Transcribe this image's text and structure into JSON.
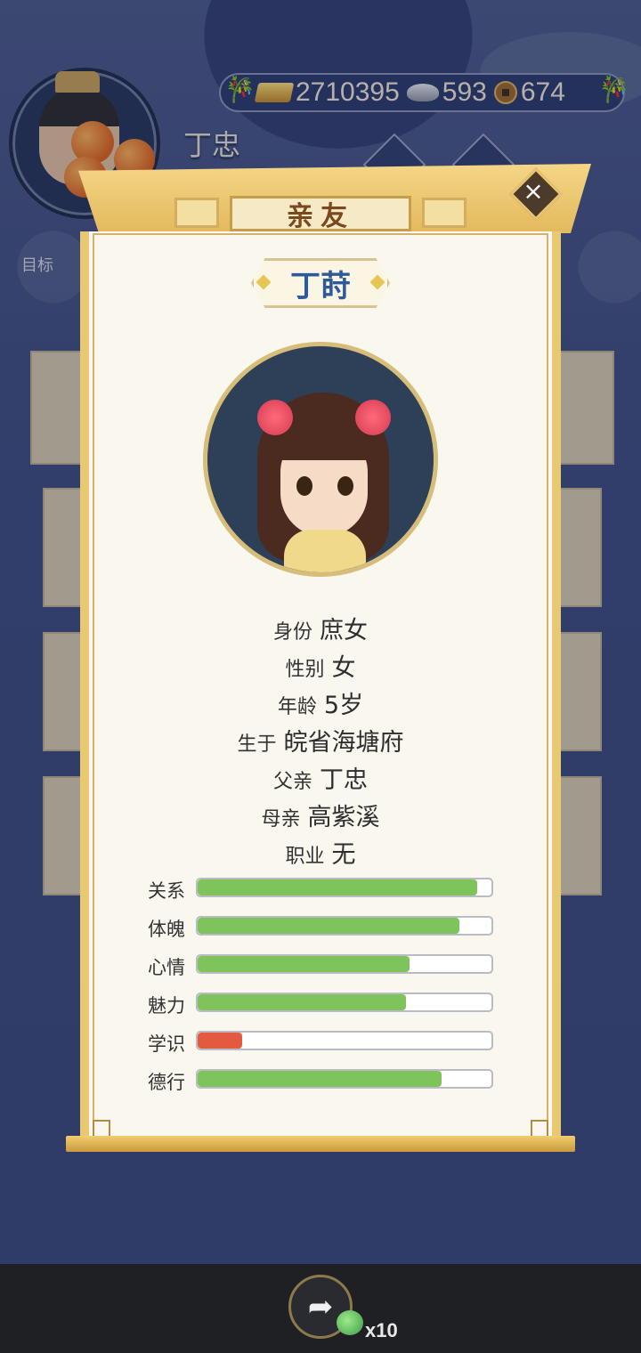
{
  "hud": {
    "player_name": "丁忠",
    "currency": {
      "gold": "2710395",
      "silver": "593",
      "copper": "674"
    },
    "goal_label": "目标"
  },
  "dialog": {
    "title": "亲友",
    "close_label": "×",
    "person_name": "丁莳",
    "info": [
      {
        "key": "身份",
        "value": "庶女"
      },
      {
        "key": "性别",
        "value": "女"
      },
      {
        "key": "年龄",
        "value": "5岁"
      },
      {
        "key": "生于",
        "value": "皖省海塘府"
      },
      {
        "key": "父亲",
        "value": "丁忠"
      },
      {
        "key": "母亲",
        "value": "高紫溪"
      },
      {
        "key": "职业",
        "value": "无"
      }
    ],
    "stats": [
      {
        "label": "关系",
        "fraction": 0.95,
        "color": "#7ec45a"
      },
      {
        "label": "体魄",
        "fraction": 0.89,
        "color": "#7ec45a"
      },
      {
        "label": "心情",
        "fraction": 0.72,
        "color": "#7ec45a"
      },
      {
        "label": "魅力",
        "fraction": 0.71,
        "color": "#7ec45a"
      },
      {
        "label": "学识",
        "fraction": 0.15,
        "color": "#e35a40"
      },
      {
        "label": "德行",
        "fraction": 0.83,
        "color": "#7ec45a"
      }
    ]
  },
  "bottom": {
    "share_count": "x10"
  },
  "icons": [
    "gold-ingot-icon",
    "silver-ingot-icon",
    "copper-coin-icon",
    "close-icon",
    "share-icon",
    "pet-icon"
  ]
}
